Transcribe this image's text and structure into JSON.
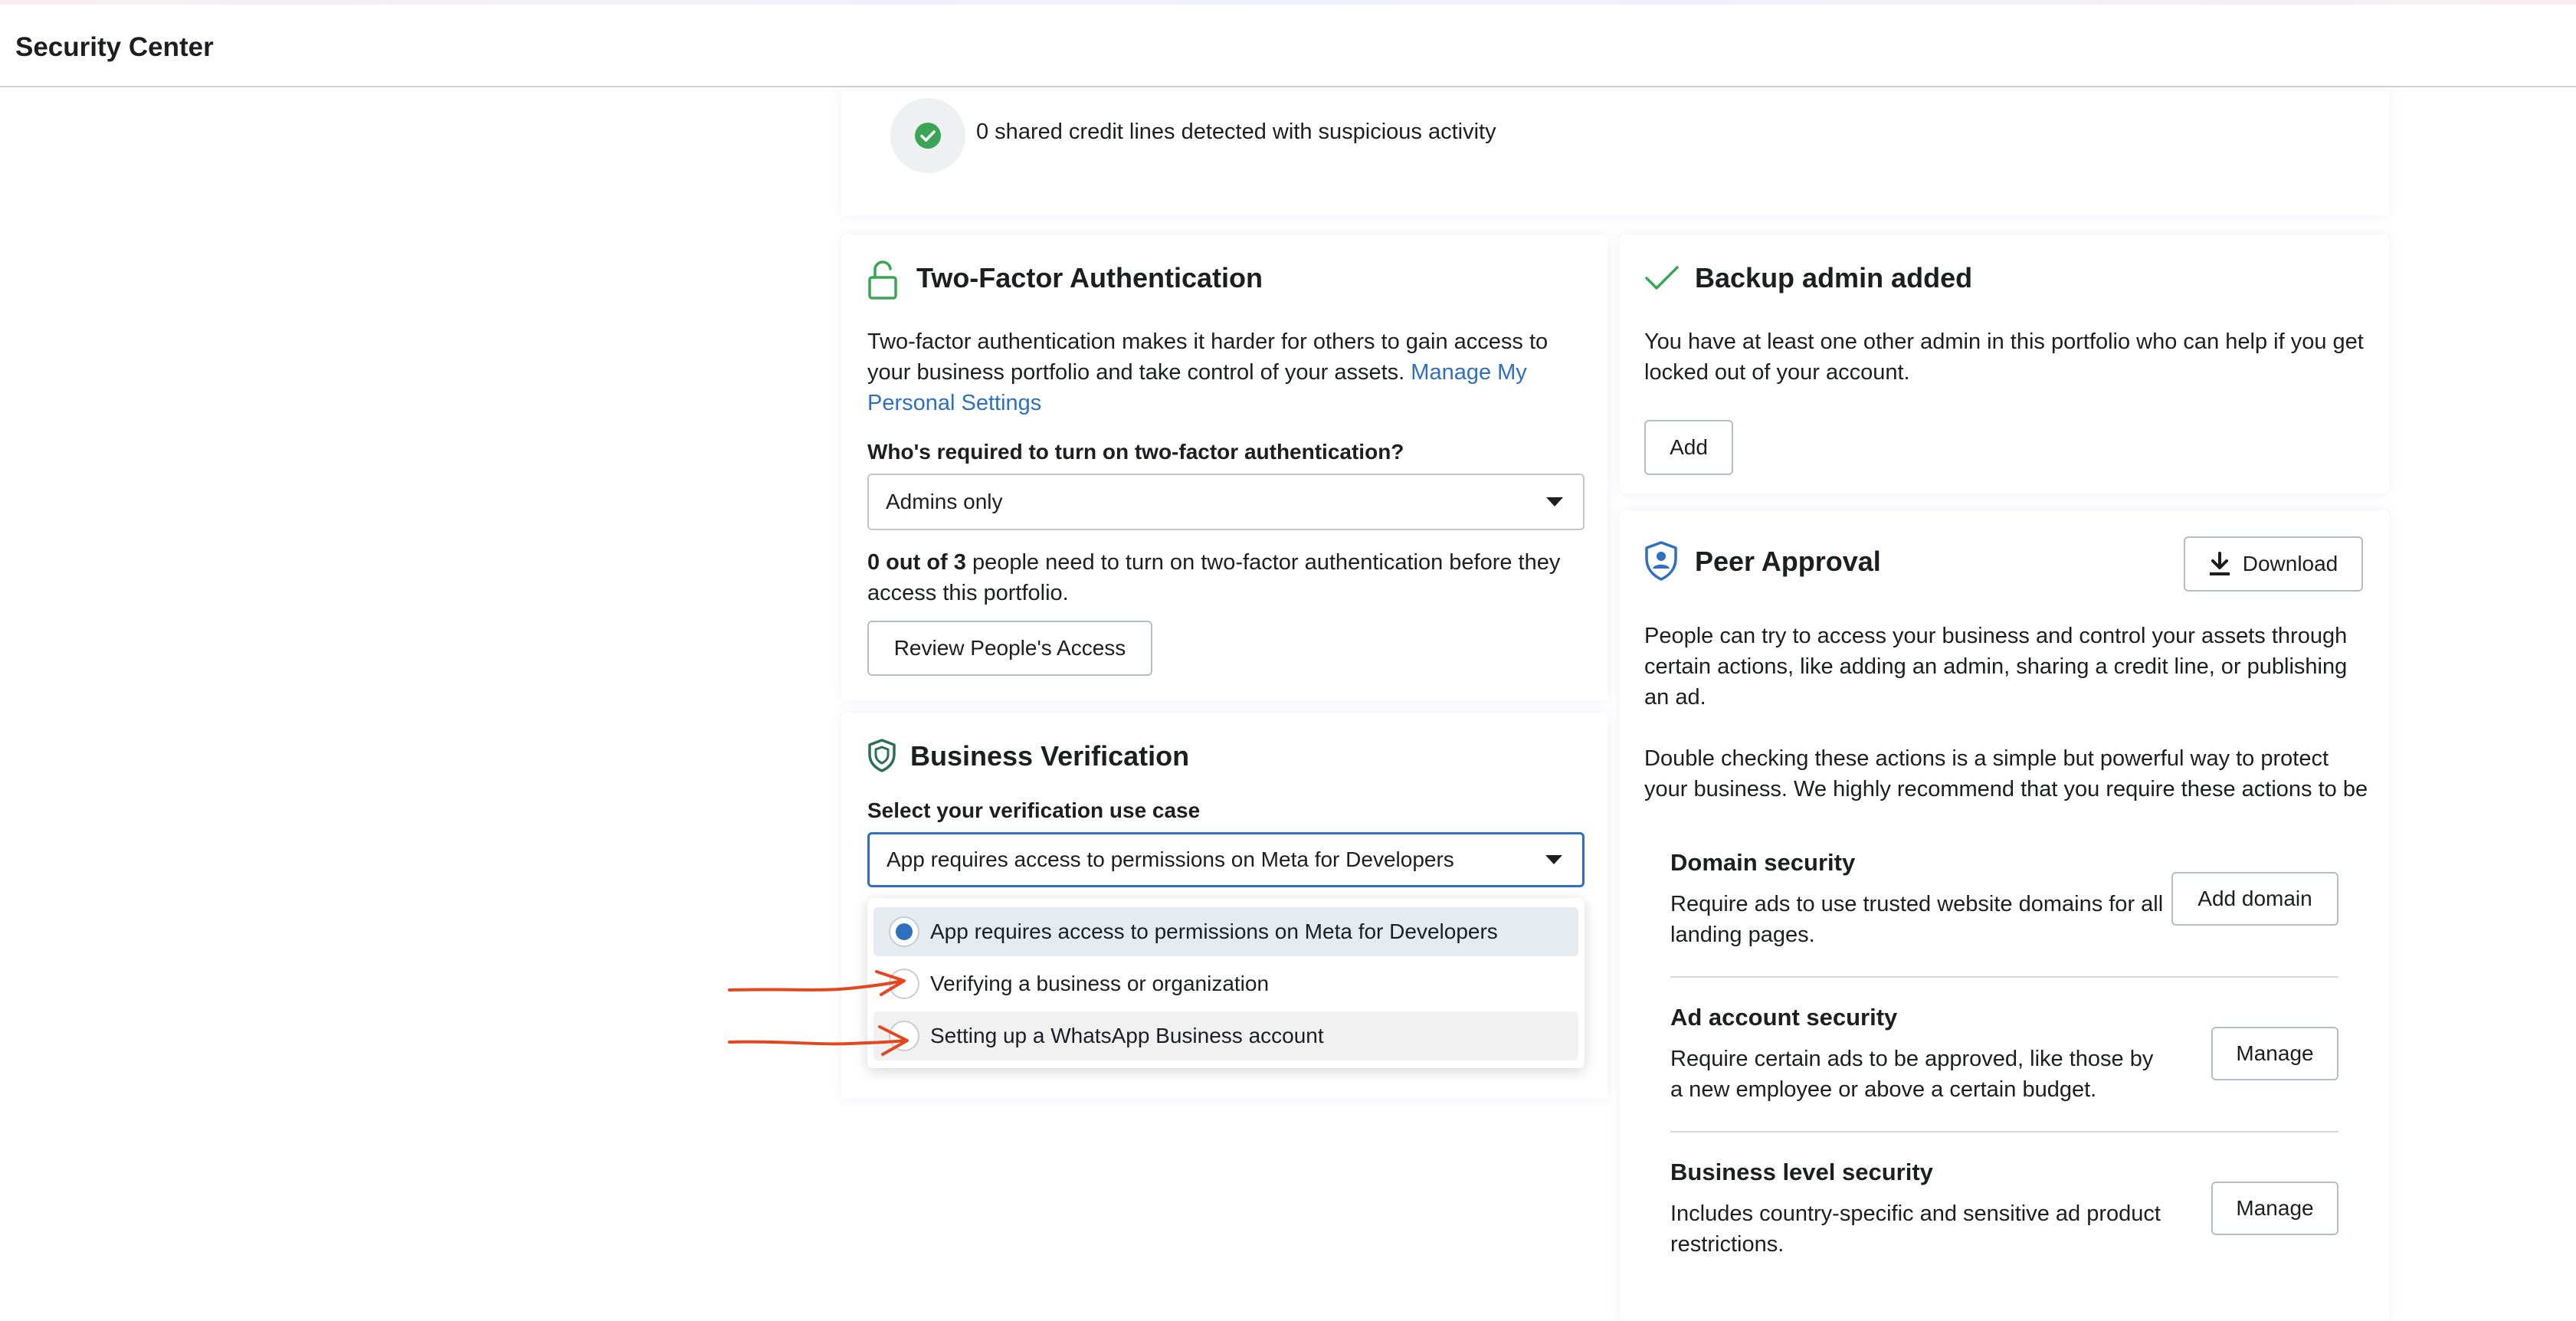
{
  "header": {
    "title": "Security Center"
  },
  "credit_lines": {
    "status_text": "0 shared credit lines detected with suspicious activity"
  },
  "two_factor": {
    "title": "Two-Factor Authentication",
    "description_1": "Two-factor authentication makes it harder for others to gain access to your business portfolio and take control of your assets.",
    "description_link": "Manage My Personal Settings",
    "question": "Who's required to turn on two-factor authentication?",
    "select_value": "Admins only",
    "count_bold": "0 out of 3",
    "count_rest": "people need to turn on two-factor authentication before they access this portfolio.",
    "review_button": "Review People's Access"
  },
  "business_verification": {
    "title": "Business Verification",
    "label": "Select your verification use case",
    "select_value": "App requires access to permissions on Meta for Developers",
    "options": [
      {
        "label": "App requires access to permissions on Meta for Developers",
        "selected": true
      },
      {
        "label": "Verifying a business or organization",
        "selected": false
      },
      {
        "label": "Setting up a WhatsApp Business account",
        "selected": false
      }
    ]
  },
  "backup_admin": {
    "title": "Backup admin added",
    "description": "You have at least one other admin in this portfolio who can help if you get locked out of your account.",
    "add_button": "Add"
  },
  "peer_approval": {
    "title": "Peer Approval",
    "download_button": "Download",
    "paragraph_1": "People can try to access your business and control your assets through certain actions, like adding an admin, sharing a credit line, or publishing an ad.",
    "paragraph_2": "Double checking these actions is a simple but powerful way to protect your business. We highly recommend that you require these actions to be",
    "items": [
      {
        "title": "Domain security",
        "description": "Require ads to use trusted website domains for all landing pages.",
        "button": "Add domain"
      },
      {
        "title": "Ad account security",
        "description": "Require certain ads to be approved, like those by a new employee or above a certain budget.",
        "button": "Manage"
      },
      {
        "title": "Business level security",
        "description": "Includes country-specific and sensitive ad product restrictions.",
        "button": "Manage"
      }
    ]
  },
  "colors": {
    "accent_blue": "#2e6fc0",
    "success_green": "#3aa655",
    "annotation_red": "#e4471f"
  },
  "icons": [
    "check-circle-icon",
    "unlock-icon",
    "shield-icon",
    "checkmark-icon",
    "shield-user-icon",
    "download-icon",
    "caret-down-icon",
    "red-arrow-annotation"
  ]
}
